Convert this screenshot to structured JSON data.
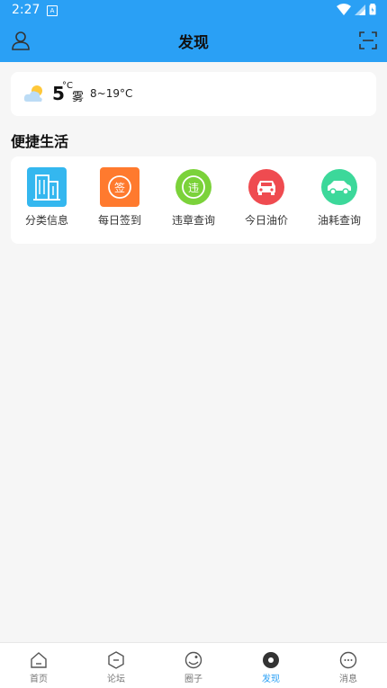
{
  "status_bar": {
    "time": "2:27",
    "sim_letter": "A"
  },
  "header": {
    "title": "发现"
  },
  "weather": {
    "temp": "5",
    "unit": "°C",
    "condition": "雾",
    "range": "8~19°C"
  },
  "section": {
    "title": "便捷生活"
  },
  "services": [
    {
      "label": "分类信息",
      "icon": "building-icon"
    },
    {
      "label": "每日签到",
      "icon": "sign-in-icon",
      "badge": "签"
    },
    {
      "label": "违章查询",
      "icon": "violation-icon",
      "badge": "违"
    },
    {
      "label": "今日油价",
      "icon": "car-front-icon"
    },
    {
      "label": "油耗查询",
      "icon": "car-side-icon"
    }
  ],
  "nav": [
    {
      "label": "首页",
      "icon": "home-icon"
    },
    {
      "label": "论坛",
      "icon": "forum-icon"
    },
    {
      "label": "圈子",
      "icon": "circle-icon"
    },
    {
      "label": "发现",
      "icon": "discover-icon",
      "active": true
    },
    {
      "label": "消息",
      "icon": "message-icon"
    }
  ],
  "colors": {
    "primary": "#2aa0f5",
    "building": "#34b7ef",
    "sign": "#ff7a2e",
    "violation": "#7bd23a",
    "oil_price": "#ef4b50",
    "consumption": "#3cd89a"
  }
}
